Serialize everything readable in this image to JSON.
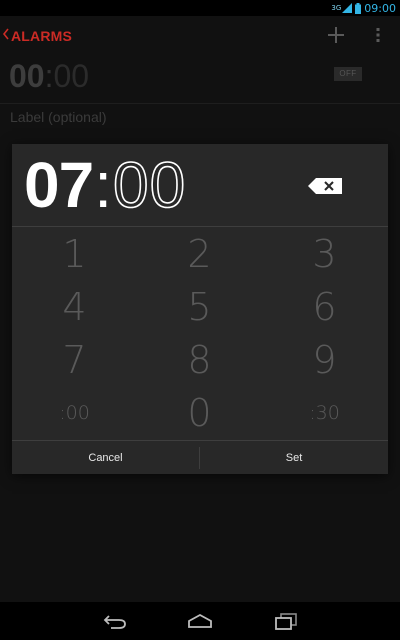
{
  "status_bar": {
    "network": "3G",
    "time": "09:00"
  },
  "action_bar": {
    "title": "ALARMS"
  },
  "background_alarm": {
    "hours": "00",
    "separator": ":",
    "minutes": "00",
    "toggle": "OFF",
    "label_placeholder": "Label (optional)"
  },
  "time_picker": {
    "hours": "07",
    "separator": ":",
    "minutes": "00",
    "keys": [
      "1",
      "2",
      "3",
      "4",
      "5",
      "6",
      "7",
      "8",
      "9",
      ":00",
      "0",
      ":30"
    ],
    "cancel_label": "Cancel",
    "set_label": "Set"
  },
  "colors": {
    "accent_red": "#cc2b25",
    "status_blue": "#33b5e5",
    "dialog_bg": "#282828"
  },
  "icons": [
    "back-caret-icon",
    "add-icon",
    "overflow-menu-icon",
    "backspace-icon",
    "nav-back-icon",
    "nav-home-icon",
    "nav-recents-icon",
    "signal-icon",
    "battery-icon"
  ]
}
